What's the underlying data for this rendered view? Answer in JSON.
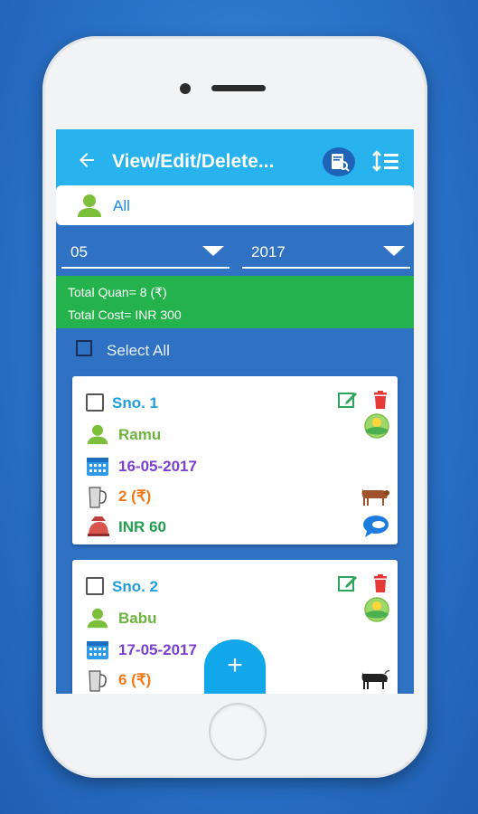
{
  "app_bar": {
    "title": "View/Edit/Delete...",
    "back_icon": "arrow-left-icon",
    "report_icon": "report-search-icon",
    "sort_icon": "sort-list-icon"
  },
  "filter": {
    "label": "All"
  },
  "dropdowns": {
    "month": "05",
    "year": "2017"
  },
  "totals": {
    "quantity": "Total Quan= 8 (₹)",
    "cost": "Total Cost= INR 300"
  },
  "select_all_label": "Select All",
  "records": [
    {
      "sno": "Sno. 1",
      "name": "Ramu",
      "date": "16-05-2017",
      "quantity": "2 (₹)",
      "amount": "INR 60",
      "animal": "cow"
    },
    {
      "sno": "Sno. 2",
      "name": "Babu",
      "date": "17-05-2017",
      "quantity": "6 (₹)",
      "animal": "buffalo"
    }
  ],
  "fab_label": "+",
  "colors": {
    "app_bar": "#29b3ee",
    "screen_bg": "#2f72c4",
    "totals_bg": "#23b24b",
    "sno": "#1e9ee0",
    "name": "#6db33f",
    "date": "#7b3fd1",
    "quantity": "#f07a1a",
    "amount": "#23a050"
  }
}
